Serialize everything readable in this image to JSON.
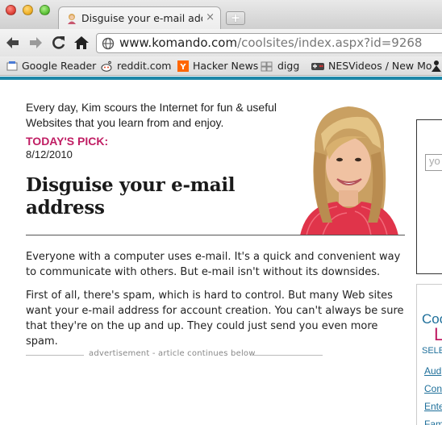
{
  "browser": {
    "tab_title": "Disguise your e-mail address",
    "tab_close": "×",
    "new_tab": "+",
    "url_host": "www.komando.com",
    "url_path": "/coolsites/index.aspx?id=9268"
  },
  "bookmarks": [
    {
      "label": "Google Reader",
      "icon": "google-reader-icon"
    },
    {
      "label": "reddit.com",
      "icon": "reddit-icon"
    },
    {
      "label": "Hacker News",
      "icon": "hacker-news-icon"
    },
    {
      "label": "digg",
      "icon": "digg-icon"
    },
    {
      "label": "NESVideos / New Mo",
      "icon": "nesvideos-icon"
    }
  ],
  "article": {
    "intro": "Every day, Kim scours the Internet for fun & useful Websites that you learn from and enjoy.",
    "pick_label": "TODAY'S PICK:",
    "date": "8/12/2010",
    "headline": "Disguise your e-mail address",
    "paragraphs": [
      "Everyone with a computer uses e-mail. It's a quick and convenient way to communicate with others. But e-mail isn't without its downsides.",
      "First of all, there's spam, which is hard to control. But many Web sites want your e-mail address for account creation. You can't always be sure that they're on the up and up. They could just send you even more spam."
    ],
    "ad_text": "advertisement - article continues below"
  },
  "sidebar": {
    "search_placeholder": "yo",
    "cool_text": "Coo",
    "l_text": "L",
    "select_text": "SELE",
    "links": [
      "Aud",
      "Con",
      "Ente",
      "Fam"
    ]
  },
  "colors": {
    "accent": "#1e87a8",
    "pick": "#c01d63",
    "link": "#1e6f9a"
  }
}
